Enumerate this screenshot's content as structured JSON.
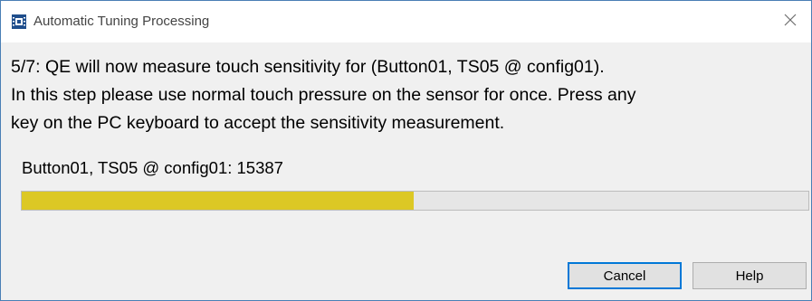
{
  "window": {
    "title": "Automatic Tuning Processing",
    "icon": "chip-icon",
    "close_icon": "close-icon"
  },
  "message": {
    "line1": "5/7: QE will now measure touch sensitivity for (Button01, TS05 @ config01).",
    "line2": "In this step please use normal touch pressure on the sensor for once. Press any",
    "line3": "key on the PC keyboard to accept the sensitivity measurement."
  },
  "measurement": {
    "label": "Button01, TS05 @ config01: 15387",
    "progress_fraction": 0.498,
    "progress_color": "#dcc825"
  },
  "buttons": {
    "cancel_label": "Cancel",
    "help_label": "Help"
  },
  "colors": {
    "accent": "#0078d7",
    "window_border": "#4a7fb5"
  }
}
